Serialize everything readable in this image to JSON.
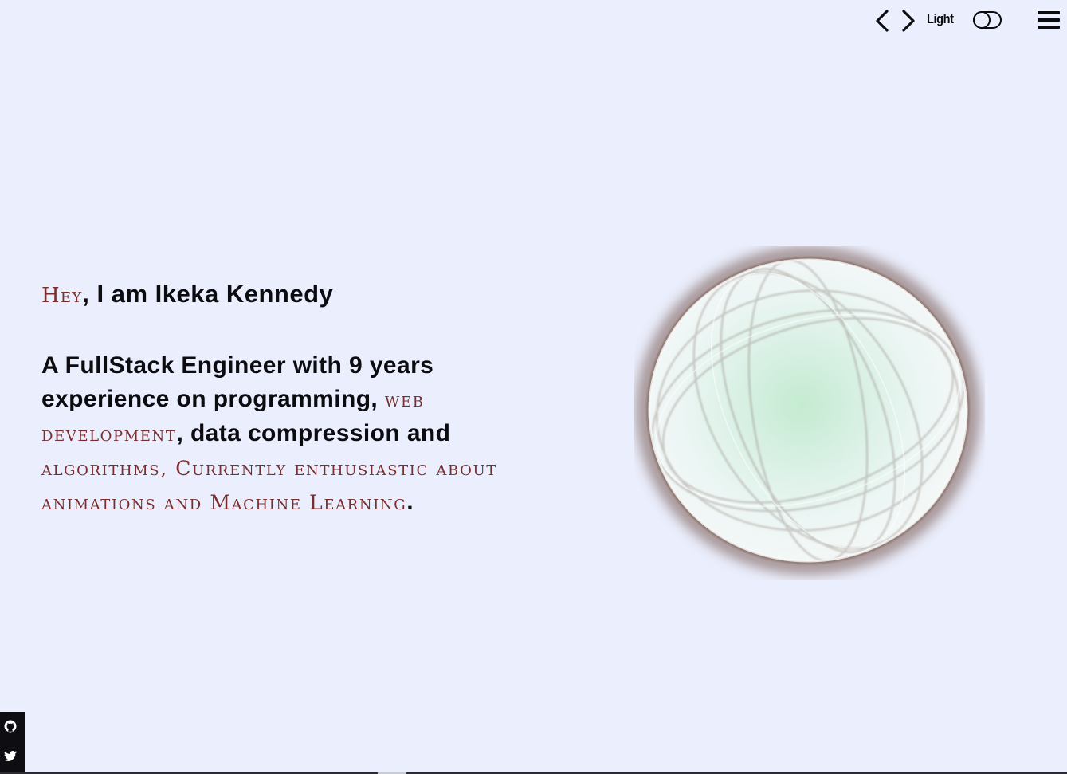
{
  "header": {
    "prev_icon": "chevron-left-icon",
    "next_icon": "chevron-right-icon",
    "theme_label": "Light",
    "theme_toggle_icon": "toggle-switch-icon",
    "menu_icon": "hamburger-menu-icon"
  },
  "hero": {
    "greeting_accent": "Hey",
    "greeting_text": ", I am Ikeka Kennedy",
    "bio_part1": "A FullStack Engineer with 9 years experience on programming, ",
    "bio_accent1": "web development",
    "bio_part2": ", data compression and ",
    "bio_accent2": "algorithms, Currently enthusiastic about animations and Machine Learning",
    "bio_end": "."
  },
  "social": {
    "github_icon": "github-icon",
    "twitter_icon": "twitter-icon"
  },
  "colors": {
    "background": "#ebeffd",
    "text": "#0b0b10",
    "accent": "#7a2d2d",
    "globe_rim": "#6b4a3f",
    "globe_glow": "#bfeccc"
  }
}
